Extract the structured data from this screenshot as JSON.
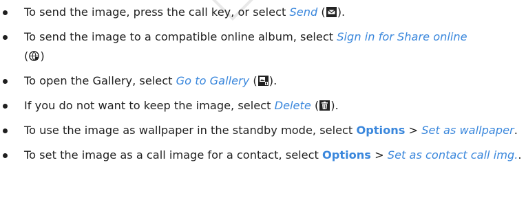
{
  "items": [
    {
      "before": "To send the image, press the call key, or select ",
      "link": "Send",
      "open": " (",
      "icon": "envelope-icon",
      "close": ")."
    },
    {
      "before": "To send the image to a compatible online album, select ",
      "link": "Sign in for Share online",
      "open": "(",
      "icon": "globe-share-icon",
      "close": ")"
    },
    {
      "before": "To open the Gallery, select ",
      "link": "Go to Gallery",
      "open": " (",
      "icon": "gallery-icon",
      "close": ")."
    },
    {
      "before": "If you do not want to keep the image, select ",
      "link": "Delete",
      "open": " (",
      "icon": "trash-icon",
      "close": ")."
    },
    {
      "before": "To use the image as wallpaper in the standby mode, select ",
      "option": "Options",
      "sep": " > ",
      "link": "Set as wallpaper",
      "close": "."
    },
    {
      "before": "To set the image as a call image for a contact, select ",
      "option": "Options",
      "sep": " > ",
      "link": "Set as contact call img.",
      "close": "."
    }
  ]
}
